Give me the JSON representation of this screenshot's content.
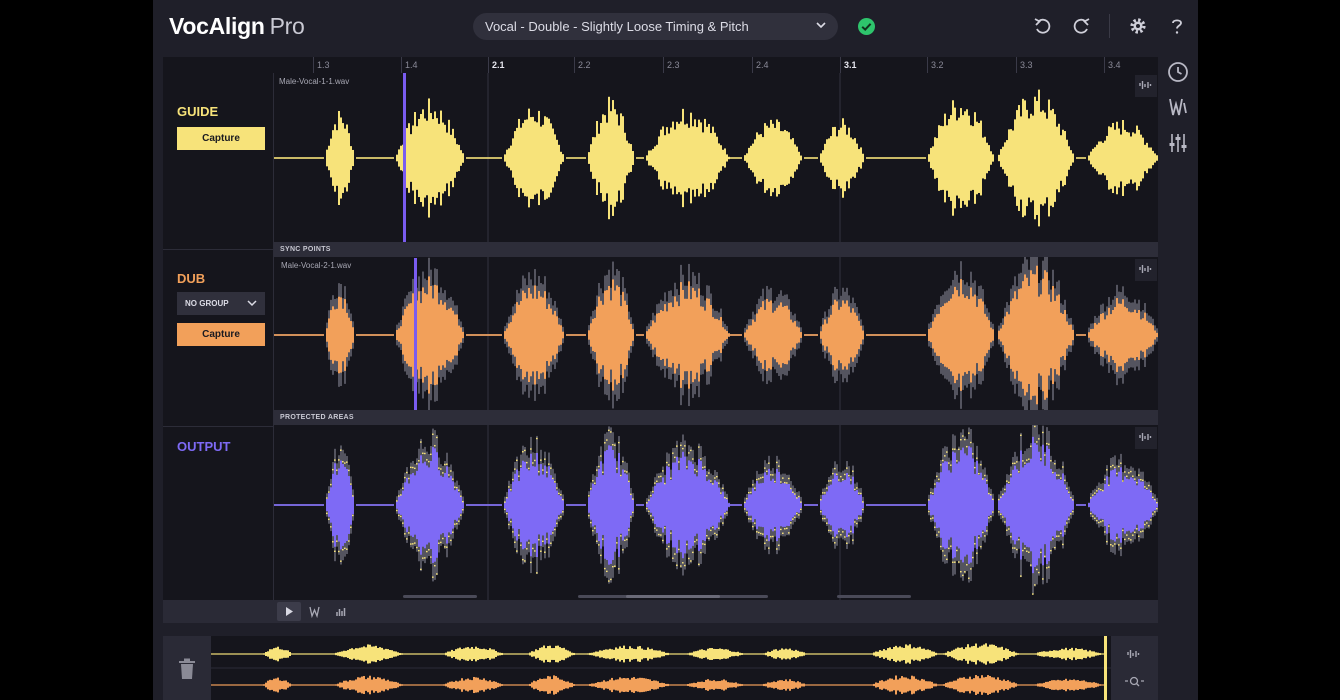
{
  "app": {
    "name": "VocAlign",
    "edition": "Pro"
  },
  "preset": {
    "label": "Vocal - Double - Slightly Loose Timing & Pitch"
  },
  "ruler": {
    "ticks": [
      "1.3",
      "1.4",
      "2.1",
      "2.2",
      "2.3",
      "2.4",
      "3.1",
      "3.2",
      "3.3",
      "3.4"
    ]
  },
  "lanes": {
    "guide": {
      "title": "GUIDE",
      "capture": "Capture",
      "file": "Male-Vocal-1-1.wav"
    },
    "dub": {
      "title": "DUB",
      "group": "NO GROUP",
      "capture": "Capture",
      "file": "Male-Vocal-2-1.wav"
    },
    "output": {
      "title": "OUTPUT"
    }
  },
  "strips": {
    "sync": "SYNC POINTS",
    "protected": "PROTECTED AREAS"
  },
  "colors": {
    "guide": "#f7e37a",
    "dub": "#f2a05a",
    "output": "#7e6af5",
    "playhead": "#7a5cf0",
    "ok": "#2ec46c"
  },
  "icons": [
    "chevron-down-icon",
    "check-circle-icon",
    "undo-icon",
    "redo-icon",
    "gear-icon",
    "help-icon",
    "history-icon",
    "warp-icon",
    "mixer-sliders-icon",
    "play-icon",
    "trash-icon",
    "zoom-icon"
  ]
}
